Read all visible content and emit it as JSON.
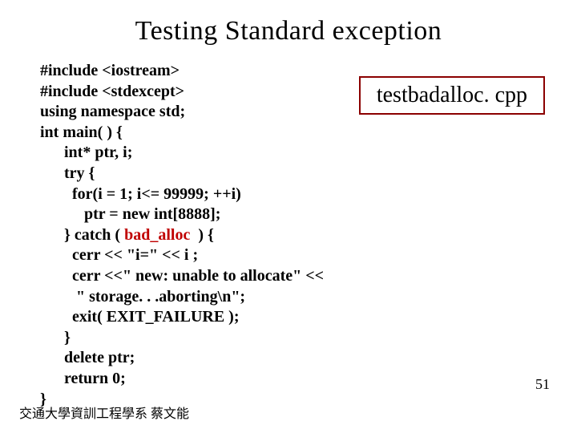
{
  "title": "Testing Standard exception",
  "filename": "testbadalloc. cpp",
  "code": {
    "l1": "#include <iostream>",
    "l2": "#include <stdexcept>",
    "l3": "using namespace std;",
    "l4": "int main( ) {",
    "l5": "      int* ptr, i;",
    "l6": "      try {",
    "l7": "        for(i = 1; i<= 99999; ++i)",
    "l8": "           ptr = new int[8888];",
    "l9a": "      } catch ( ",
    "l9b": "bad_alloc",
    "l9c": "  ) {",
    "l10": "        cerr << \"i=\" << i ;",
    "l11": "        cerr <<\" new: unable to allocate\" <<",
    "l12": "         \" storage. . .aborting\\n\";",
    "l13": "        exit( EXIT_FAILURE );",
    "l14": "      }",
    "l15": "      delete ptr;",
    "l16": "      return 0;",
    "l17": "}"
  },
  "footer": "交通大學資訓工程學系 蔡文能",
  "page": "51"
}
